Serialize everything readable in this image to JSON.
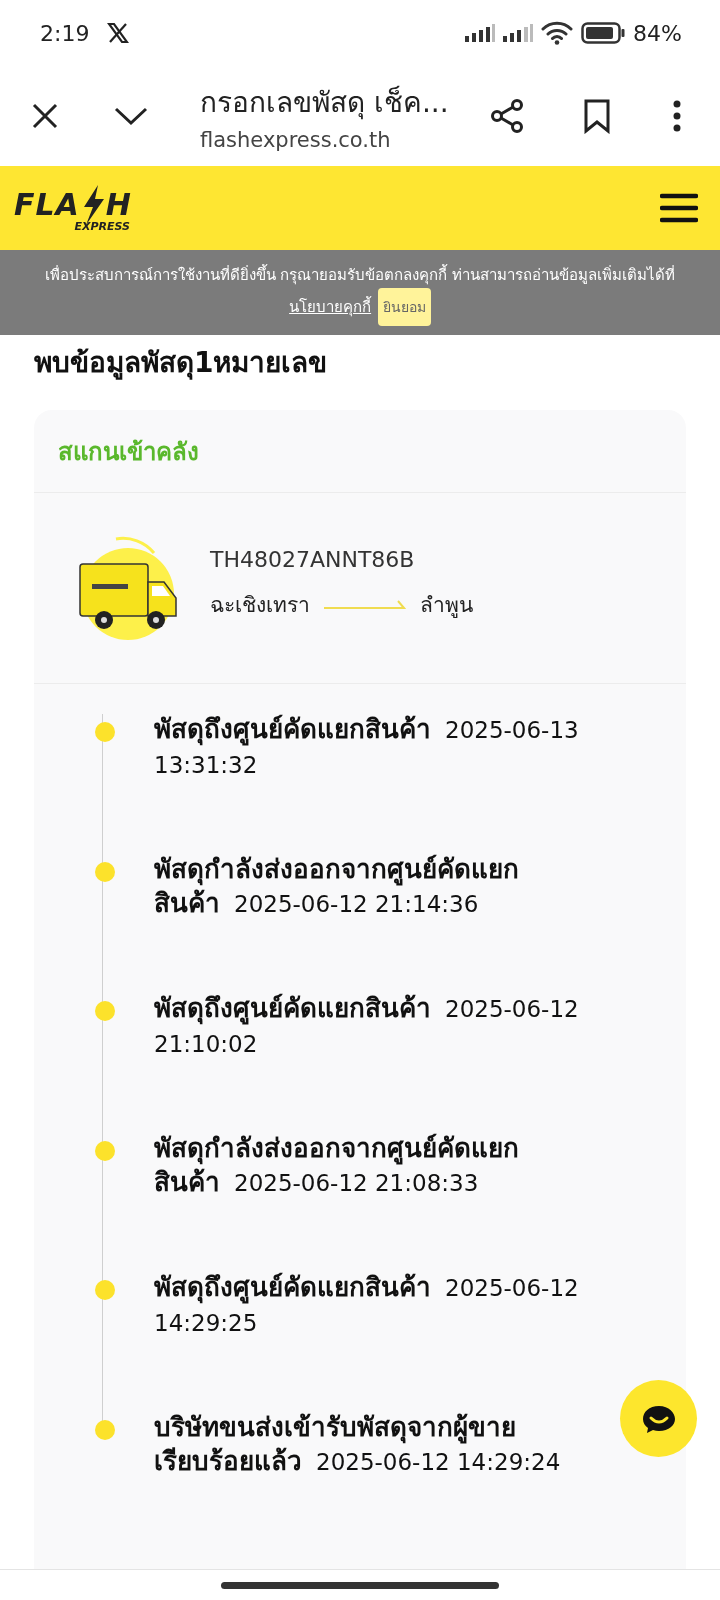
{
  "status_bar": {
    "time": "2:19",
    "battery": "84%"
  },
  "browser": {
    "title": "กรอกเลขพัสดุ เช็ค...",
    "url": "flashexpress.co.th"
  },
  "site_header": {
    "logo": {
      "main": "FLA",
      "end": "H",
      "sub": "EXPRESS"
    }
  },
  "cookie_banner": {
    "text": "เพื่อประสบการณ์การใช้งานที่ดียิ่งขึ้น  กรุณายอมรับข้อตกลงคุกกี้  ท่านสามารถอ่านข้อมูลเพิ่มเติมได้ที่",
    "link": "นโยบายคุกกี้",
    "button": "ยินยอม"
  },
  "heading": "พบข้อมูลพัสดุ1หมายเลข",
  "card": {
    "status": "สแกนเข้าคลัง",
    "tracking_number": "TH48027ANNT86B",
    "origin": "ฉะเชิงเทรา",
    "destination": "ลำพูน",
    "events": [
      {
        "title": "พัสดุถึงศูนย์คัดแยกสินค้า",
        "time": "2025-06-13 13:31:32"
      },
      {
        "title": "พัสดุกำลังส่งออกจากศูนย์คัดแยกสินค้า",
        "time": "2025-06-12 21:14:36"
      },
      {
        "title": "พัสดุถึงศูนย์คัดแยกสินค้า",
        "time": "2025-06-12 21:10:02"
      },
      {
        "title": "พัสดุกำลังส่งออกจากศูนย์คัดแยกสินค้า",
        "time": "2025-06-12 21:08:33"
      },
      {
        "title": "พัสดุถึงศูนย์คัดแยกสินค้า",
        "time": "2025-06-12 14:29:25"
      },
      {
        "title": "บริษัทขนส่งเข้ารับพัสดุจากผู้ขายเรียบร้อยแล้ว",
        "time": "2025-06-12 14:29:24"
      }
    ]
  }
}
